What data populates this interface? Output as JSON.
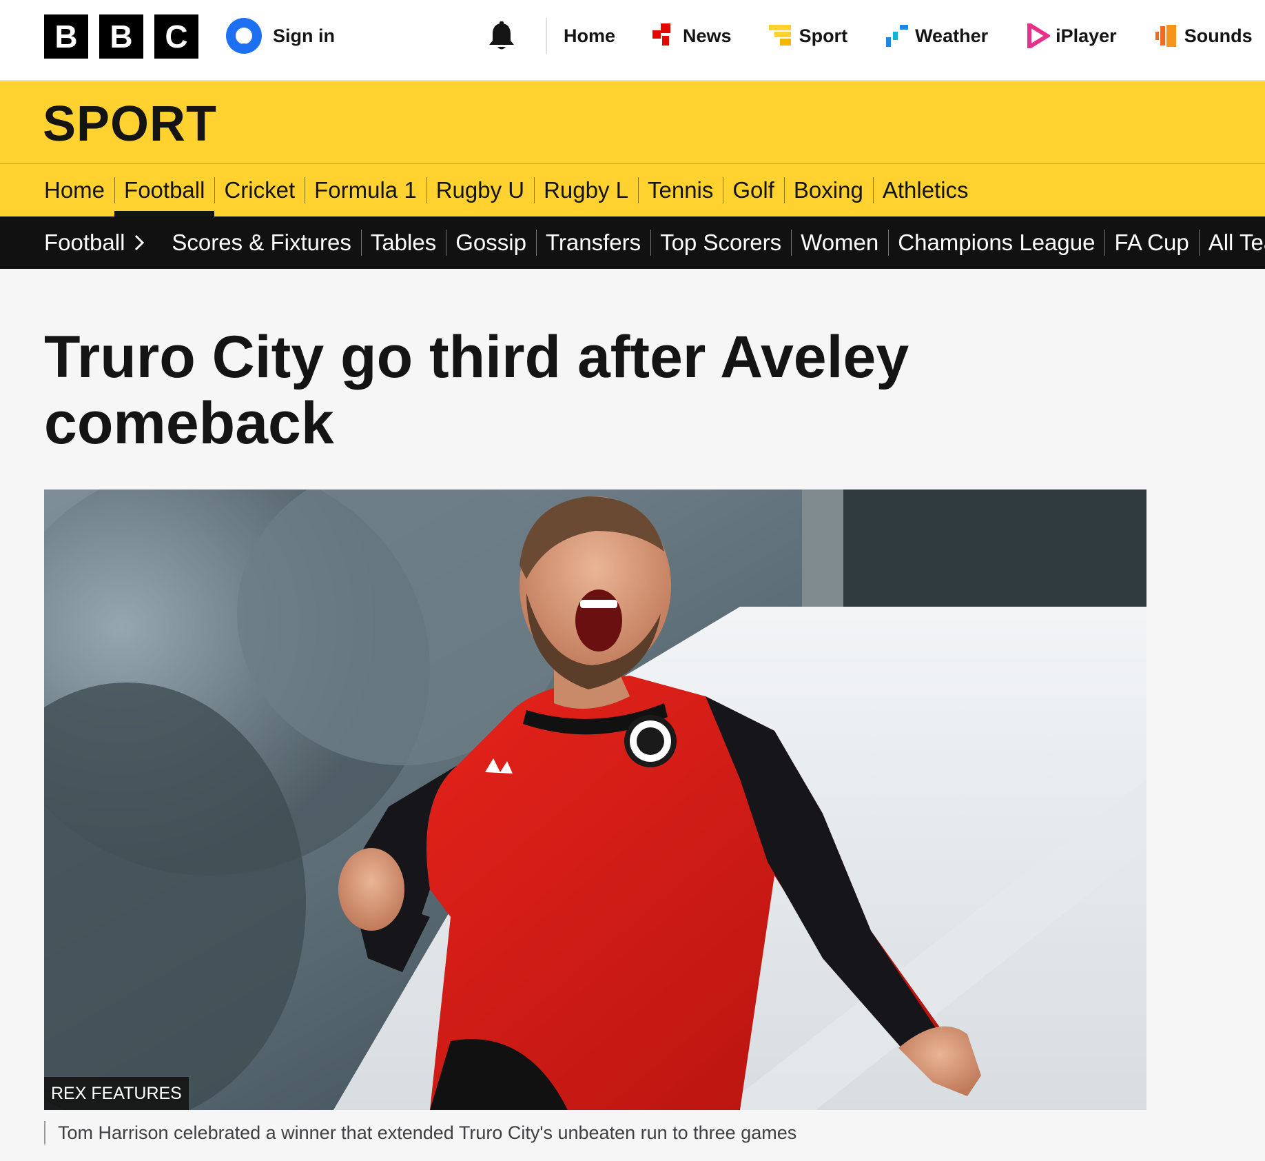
{
  "brand": {
    "logo_letters": [
      "B",
      "B",
      "C"
    ],
    "signin_label": "Sign in"
  },
  "top_nav": [
    {
      "label": "Home",
      "icon": null
    },
    {
      "label": "News",
      "icon": "news-icon"
    },
    {
      "label": "Sport",
      "icon": "sport-icon"
    },
    {
      "label": "Weather",
      "icon": "weather-icon"
    },
    {
      "label": "iPlayer",
      "icon": "iplayer-icon"
    },
    {
      "label": "Sounds",
      "icon": "sounds-icon"
    }
  ],
  "section": {
    "title": "SPORT"
  },
  "sport_nav": [
    {
      "label": "Home",
      "active": false
    },
    {
      "label": "Football",
      "active": true
    },
    {
      "label": "Cricket",
      "active": false
    },
    {
      "label": "Formula 1",
      "active": false
    },
    {
      "label": "Rugby U",
      "active": false
    },
    {
      "label": "Rugby L",
      "active": false
    },
    {
      "label": "Tennis",
      "active": false
    },
    {
      "label": "Golf",
      "active": false
    },
    {
      "label": "Boxing",
      "active": false
    },
    {
      "label": "Athletics",
      "active": false
    }
  ],
  "sub_nav": {
    "breadcrumb": "Football",
    "items": [
      "Scores & Fixtures",
      "Tables",
      "Gossip",
      "Transfers",
      "Top Scorers",
      "Women",
      "Champions League",
      "FA Cup",
      "All Teams"
    ]
  },
  "article": {
    "headline_line1": "Truro City go third after Aveley",
    "headline_line2": "comeback",
    "image_credit": "REX FEATURES",
    "caption": "Tom Harrison celebrated a winner that extended Truro City's unbeaten run to three games"
  },
  "colors": {
    "sport_yellow": "#ffd230",
    "subnav_black": "#111111",
    "signin_blue": "#1d70f2",
    "news_red": "#e10600",
    "sport_yellow_icon": "#ffd230",
    "weather_blue": "#1e88e5",
    "iplayer_pink": "#e5318a",
    "sounds_orange": "#f26a21"
  }
}
